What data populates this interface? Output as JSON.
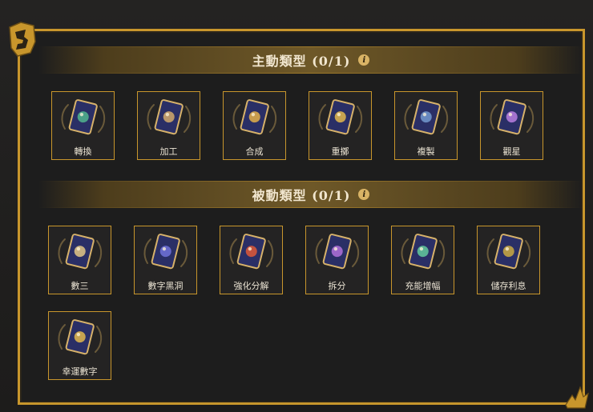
{
  "sections": [
    {
      "title": "主動類型 (0/1)",
      "cards": [
        {
          "label": "轉換",
          "icon": "exchange-arrows-icon",
          "accent": "#4fae8c"
        },
        {
          "label": "加工",
          "icon": "number-card-icon",
          "accent": "#c9a36a"
        },
        {
          "label": "合成",
          "icon": "gold-cubes-icon",
          "accent": "#d8a84a"
        },
        {
          "label": "重擲",
          "icon": "reroll-cube-icon",
          "accent": "#d8b04e"
        },
        {
          "label": "複製",
          "icon": "duplicate-card-icon",
          "accent": "#6f93c9"
        },
        {
          "label": "觀星",
          "icon": "constellation-orbs-icon",
          "accent": "#b07ad8"
        }
      ]
    },
    {
      "title": "被動類型 (0/1)",
      "cards": [
        {
          "label": "數三",
          "icon": "dice-three-icon",
          "accent": "#d8bf84"
        },
        {
          "label": "數字黑洞",
          "icon": "black-hole-icon",
          "accent": "#6b6fd4"
        },
        {
          "label": "強化分解",
          "icon": "upgrade-box-icon",
          "accent": "#d4563a"
        },
        {
          "label": "拆分",
          "icon": "split-orbs-icon",
          "accent": "#a86ed4"
        },
        {
          "label": "充能增幅",
          "icon": "charge-cube-icon",
          "accent": "#5fc29a"
        },
        {
          "label": "儲存利息",
          "icon": "crystal-interest-icon",
          "accent": "#c2a444"
        },
        {
          "label": "幸運數字",
          "icon": "lucky-number-icon",
          "accent": "#d8b04e"
        }
      ]
    }
  ],
  "colors": {
    "frame_gold": "#c8962c",
    "card_back": "#2a2f66"
  }
}
